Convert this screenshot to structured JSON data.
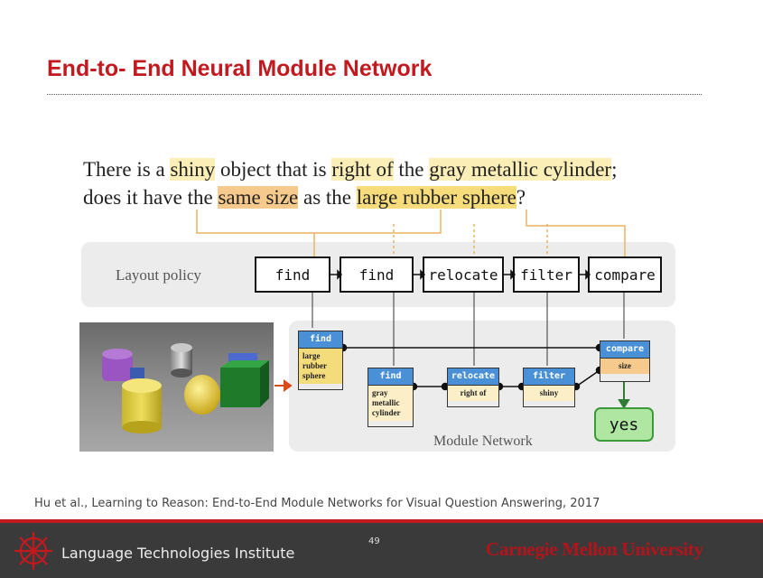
{
  "slide": {
    "title": "End-to- End Neural Module Network",
    "citation": "Hu et al., Learning to Reason: End-to-End Module Networks for Visual Question Answering, 2017",
    "page_number": "49"
  },
  "question": {
    "line1": [
      "There is a ",
      "shiny",
      " object that is ",
      "right of",
      " the ",
      "gray metallic cylinder",
      ";"
    ],
    "line2": [
      "does it have the ",
      "same size",
      " as the ",
      "large rubber sphere",
      "?"
    ]
  },
  "layout_policy": {
    "label": "Layout policy",
    "modules": [
      "find",
      "find",
      "relocate",
      "filter",
      "compare"
    ]
  },
  "module_network": {
    "label": "Module Network",
    "modules": [
      {
        "name": "find",
        "arg": "large rubber sphere"
      },
      {
        "name": "find",
        "arg": "gray metallic cylinder"
      },
      {
        "name": "relocate",
        "arg": "right of"
      },
      {
        "name": "filter",
        "arg": "shiny"
      },
      {
        "name": "compare",
        "arg": "size"
      }
    ],
    "answer": "yes"
  },
  "footer": {
    "institute": "Language Technologies Institute",
    "university": "Carnegie Mellon University"
  },
  "colors": {
    "title_red": "#c2191f",
    "module_header_blue": "#4a90d6",
    "highlight_yellow": "#fbeeb6",
    "highlight_orange": "#f6c98c",
    "answer_green": "#aee6a2"
  }
}
